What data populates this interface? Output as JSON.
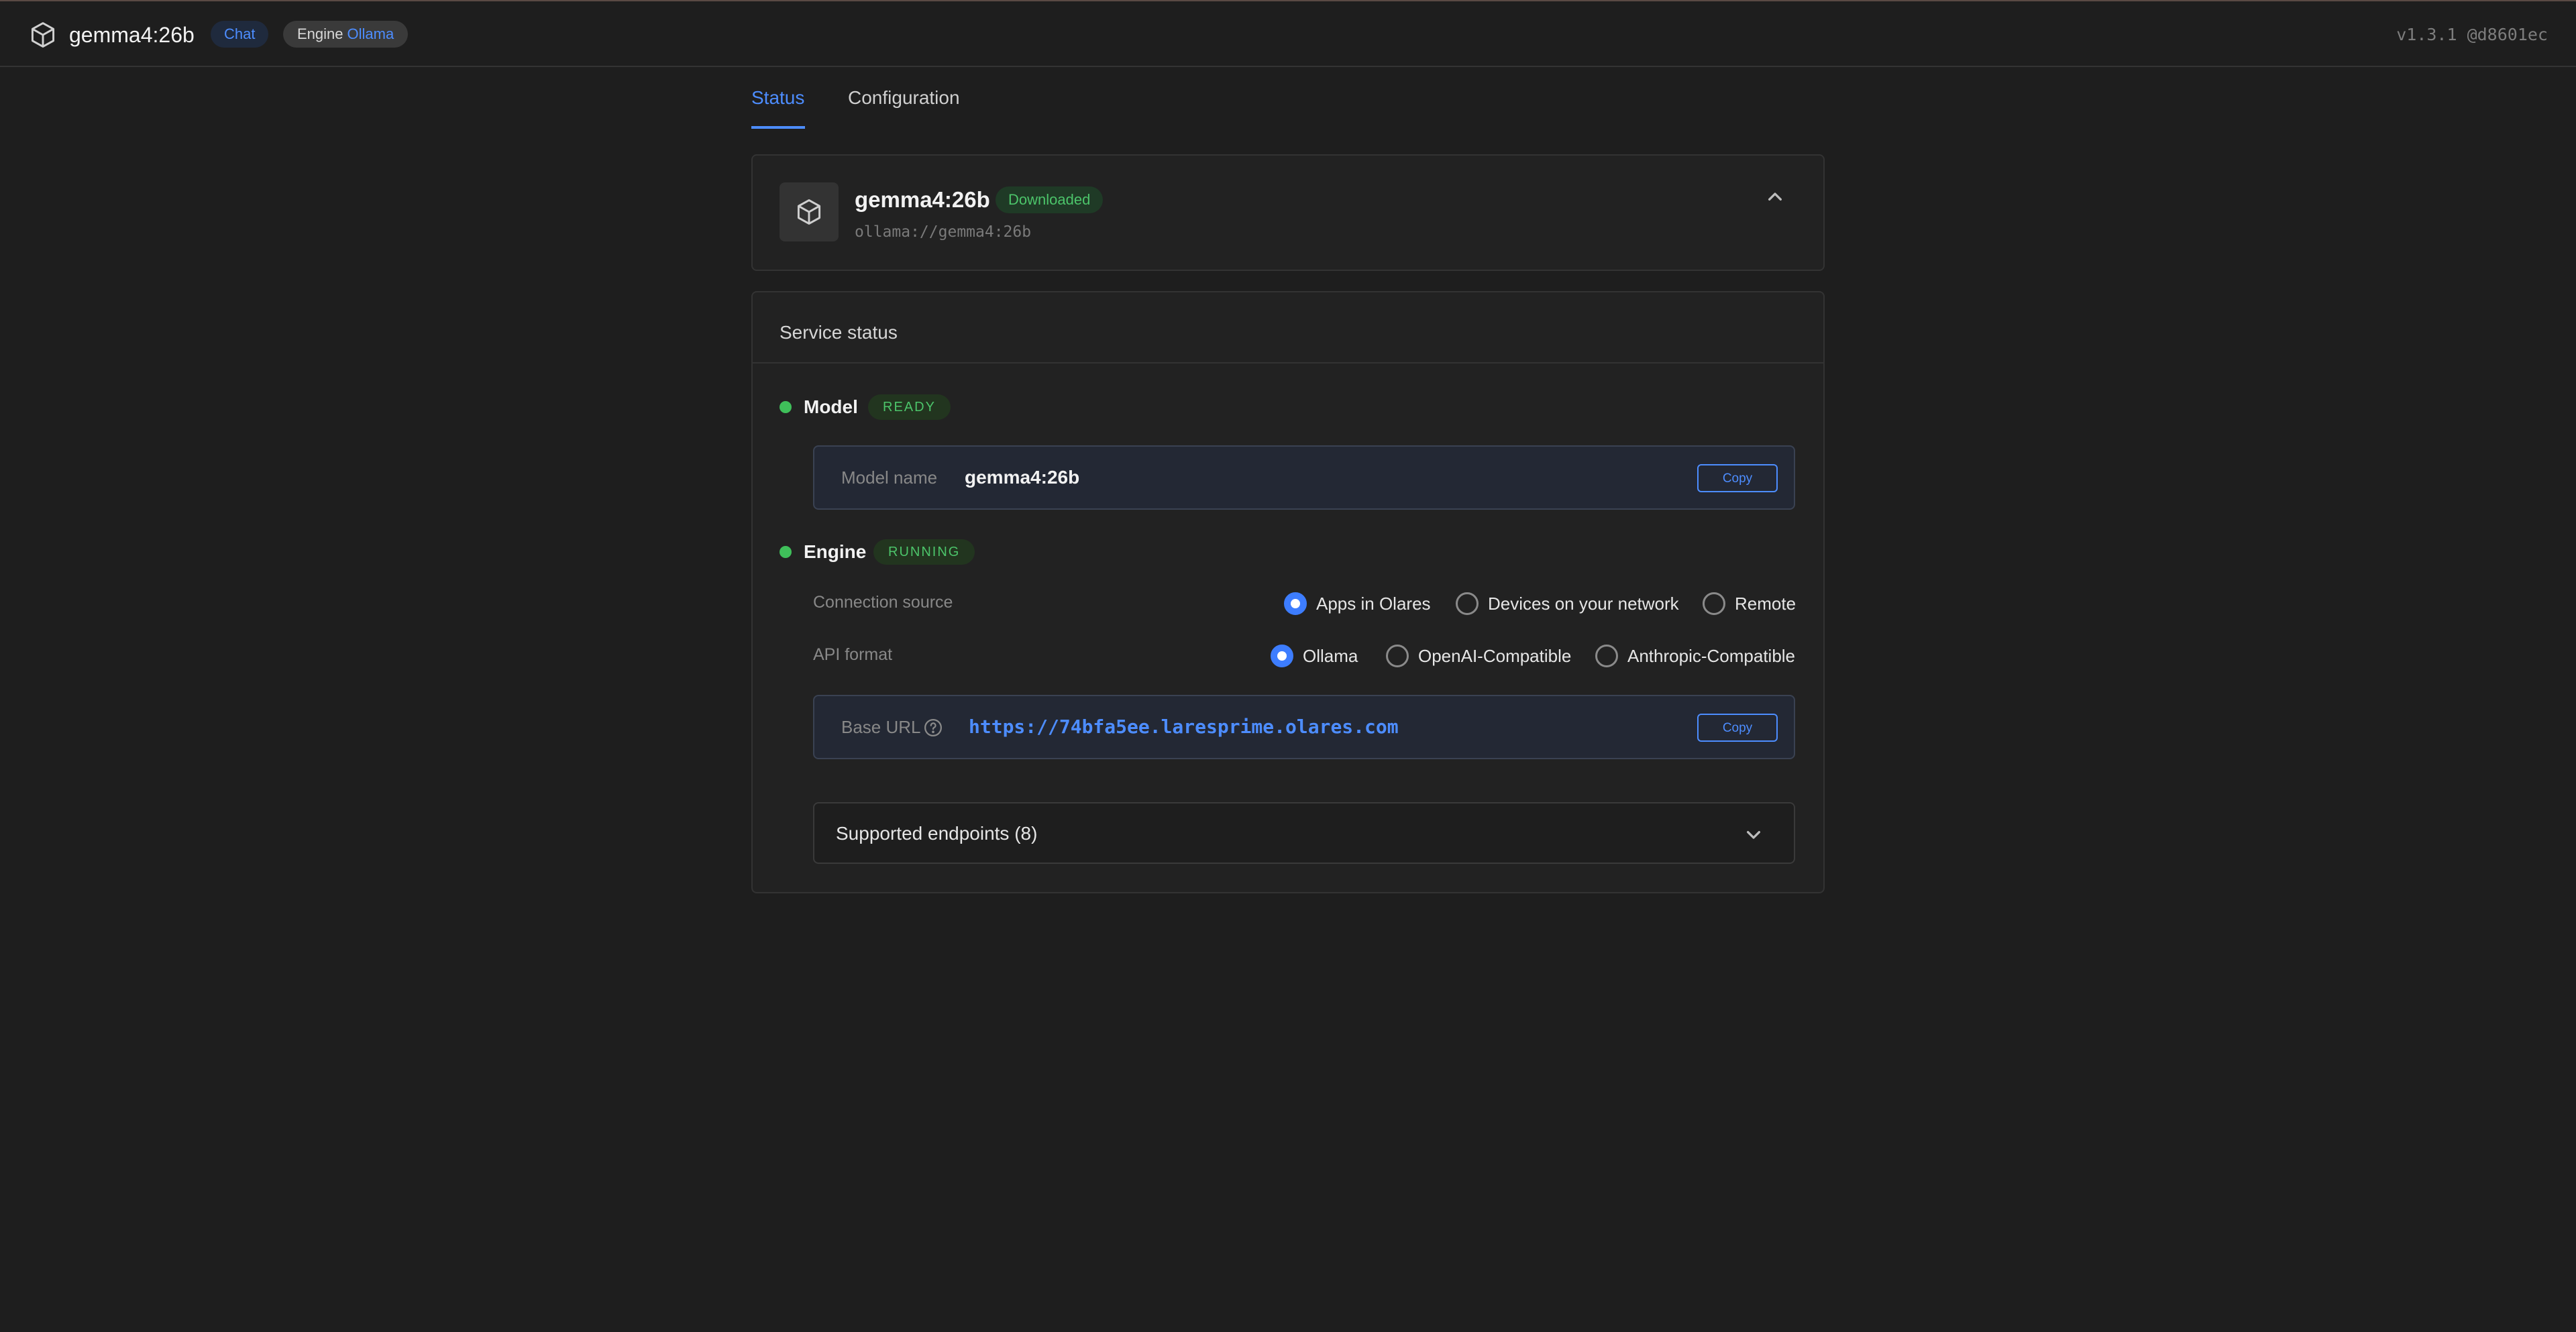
{
  "header": {
    "title": "gemma4:26b",
    "chat_label": "Chat",
    "engine_label": "Engine",
    "engine_value": "Ollama",
    "version": "v1.3.1 @d8601ec"
  },
  "tabs": [
    {
      "label": "Status",
      "active": true
    },
    {
      "label": "Configuration",
      "active": false
    }
  ],
  "model_card": {
    "name": "gemma4:26b",
    "status": "Downloaded",
    "uri": "ollama://gemma4:26b"
  },
  "service": {
    "title": "Service status",
    "model": {
      "label": "Model",
      "status": "READY",
      "field_label": "Model name",
      "field_value": "gemma4:26b",
      "copy_label": "Copy"
    },
    "engine": {
      "label": "Engine",
      "status": "RUNNING",
      "connection_label": "Connection source",
      "connection_options": [
        "Apps in Olares",
        "Devices on your network",
        "Remote"
      ],
      "connection_selected": "Apps in Olares",
      "api_label": "API format",
      "api_options": [
        "Ollama",
        "OpenAI-Compatible",
        "Anthropic-Compatible"
      ],
      "api_selected": "Ollama",
      "base_url_label": "Base URL",
      "base_url": "https://74bfa5ee.laresprime.olares.com",
      "copy_label": "Copy"
    },
    "endpoints_label": "Supported endpoints (8)"
  },
  "colors": {
    "accent": "#4d8dff",
    "success": "#3fbf5a",
    "background": "#1e1e1e",
    "card": "#222222"
  },
  "icons": {
    "brand": "cube-icon",
    "model": "cube-icon",
    "collapse": "chevron-up-icon",
    "expand": "chevron-down-icon",
    "help": "question-circle-icon"
  }
}
